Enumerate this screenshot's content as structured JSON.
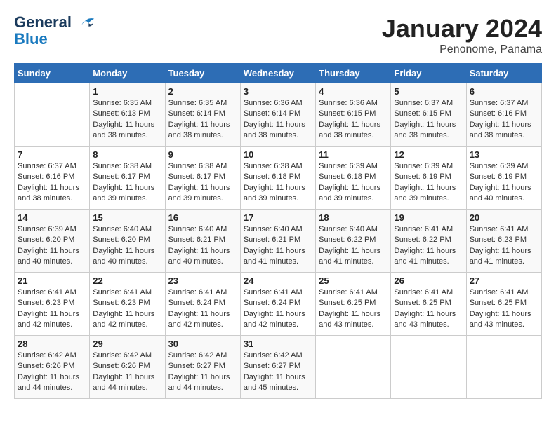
{
  "header": {
    "logo_line1": "General",
    "logo_line2": "Blue",
    "month": "January 2024",
    "location": "Penonome, Panama"
  },
  "weekdays": [
    "Sunday",
    "Monday",
    "Tuesday",
    "Wednesday",
    "Thursday",
    "Friday",
    "Saturday"
  ],
  "weeks": [
    [
      {
        "day": "",
        "sunrise": "",
        "sunset": "",
        "daylight": ""
      },
      {
        "day": "1",
        "sunrise": "Sunrise: 6:35 AM",
        "sunset": "Sunset: 6:13 PM",
        "daylight": "Daylight: 11 hours and 38 minutes."
      },
      {
        "day": "2",
        "sunrise": "Sunrise: 6:35 AM",
        "sunset": "Sunset: 6:14 PM",
        "daylight": "Daylight: 11 hours and 38 minutes."
      },
      {
        "day": "3",
        "sunrise": "Sunrise: 6:36 AM",
        "sunset": "Sunset: 6:14 PM",
        "daylight": "Daylight: 11 hours and 38 minutes."
      },
      {
        "day": "4",
        "sunrise": "Sunrise: 6:36 AM",
        "sunset": "Sunset: 6:15 PM",
        "daylight": "Daylight: 11 hours and 38 minutes."
      },
      {
        "day": "5",
        "sunrise": "Sunrise: 6:37 AM",
        "sunset": "Sunset: 6:15 PM",
        "daylight": "Daylight: 11 hours and 38 minutes."
      },
      {
        "day": "6",
        "sunrise": "Sunrise: 6:37 AM",
        "sunset": "Sunset: 6:16 PM",
        "daylight": "Daylight: 11 hours and 38 minutes."
      }
    ],
    [
      {
        "day": "7",
        "sunrise": "Sunrise: 6:37 AM",
        "sunset": "Sunset: 6:16 PM",
        "daylight": "Daylight: 11 hours and 38 minutes."
      },
      {
        "day": "8",
        "sunrise": "Sunrise: 6:38 AM",
        "sunset": "Sunset: 6:17 PM",
        "daylight": "Daylight: 11 hours and 39 minutes."
      },
      {
        "day": "9",
        "sunrise": "Sunrise: 6:38 AM",
        "sunset": "Sunset: 6:17 PM",
        "daylight": "Daylight: 11 hours and 39 minutes."
      },
      {
        "day": "10",
        "sunrise": "Sunrise: 6:38 AM",
        "sunset": "Sunset: 6:18 PM",
        "daylight": "Daylight: 11 hours and 39 minutes."
      },
      {
        "day": "11",
        "sunrise": "Sunrise: 6:39 AM",
        "sunset": "Sunset: 6:18 PM",
        "daylight": "Daylight: 11 hours and 39 minutes."
      },
      {
        "day": "12",
        "sunrise": "Sunrise: 6:39 AM",
        "sunset": "Sunset: 6:19 PM",
        "daylight": "Daylight: 11 hours and 39 minutes."
      },
      {
        "day": "13",
        "sunrise": "Sunrise: 6:39 AM",
        "sunset": "Sunset: 6:19 PM",
        "daylight": "Daylight: 11 hours and 40 minutes."
      }
    ],
    [
      {
        "day": "14",
        "sunrise": "Sunrise: 6:39 AM",
        "sunset": "Sunset: 6:20 PM",
        "daylight": "Daylight: 11 hours and 40 minutes."
      },
      {
        "day": "15",
        "sunrise": "Sunrise: 6:40 AM",
        "sunset": "Sunset: 6:20 PM",
        "daylight": "Daylight: 11 hours and 40 minutes."
      },
      {
        "day": "16",
        "sunrise": "Sunrise: 6:40 AM",
        "sunset": "Sunset: 6:21 PM",
        "daylight": "Daylight: 11 hours and 40 minutes."
      },
      {
        "day": "17",
        "sunrise": "Sunrise: 6:40 AM",
        "sunset": "Sunset: 6:21 PM",
        "daylight": "Daylight: 11 hours and 41 minutes."
      },
      {
        "day": "18",
        "sunrise": "Sunrise: 6:40 AM",
        "sunset": "Sunset: 6:22 PM",
        "daylight": "Daylight: 11 hours and 41 minutes."
      },
      {
        "day": "19",
        "sunrise": "Sunrise: 6:41 AM",
        "sunset": "Sunset: 6:22 PM",
        "daylight": "Daylight: 11 hours and 41 minutes."
      },
      {
        "day": "20",
        "sunrise": "Sunrise: 6:41 AM",
        "sunset": "Sunset: 6:23 PM",
        "daylight": "Daylight: 11 hours and 41 minutes."
      }
    ],
    [
      {
        "day": "21",
        "sunrise": "Sunrise: 6:41 AM",
        "sunset": "Sunset: 6:23 PM",
        "daylight": "Daylight: 11 hours and 42 minutes."
      },
      {
        "day": "22",
        "sunrise": "Sunrise: 6:41 AM",
        "sunset": "Sunset: 6:23 PM",
        "daylight": "Daylight: 11 hours and 42 minutes."
      },
      {
        "day": "23",
        "sunrise": "Sunrise: 6:41 AM",
        "sunset": "Sunset: 6:24 PM",
        "daylight": "Daylight: 11 hours and 42 minutes."
      },
      {
        "day": "24",
        "sunrise": "Sunrise: 6:41 AM",
        "sunset": "Sunset: 6:24 PM",
        "daylight": "Daylight: 11 hours and 42 minutes."
      },
      {
        "day": "25",
        "sunrise": "Sunrise: 6:41 AM",
        "sunset": "Sunset: 6:25 PM",
        "daylight": "Daylight: 11 hours and 43 minutes."
      },
      {
        "day": "26",
        "sunrise": "Sunrise: 6:41 AM",
        "sunset": "Sunset: 6:25 PM",
        "daylight": "Daylight: 11 hours and 43 minutes."
      },
      {
        "day": "27",
        "sunrise": "Sunrise: 6:41 AM",
        "sunset": "Sunset: 6:25 PM",
        "daylight": "Daylight: 11 hours and 43 minutes."
      }
    ],
    [
      {
        "day": "28",
        "sunrise": "Sunrise: 6:42 AM",
        "sunset": "Sunset: 6:26 PM",
        "daylight": "Daylight: 11 hours and 44 minutes."
      },
      {
        "day": "29",
        "sunrise": "Sunrise: 6:42 AM",
        "sunset": "Sunset: 6:26 PM",
        "daylight": "Daylight: 11 hours and 44 minutes."
      },
      {
        "day": "30",
        "sunrise": "Sunrise: 6:42 AM",
        "sunset": "Sunset: 6:27 PM",
        "daylight": "Daylight: 11 hours and 44 minutes."
      },
      {
        "day": "31",
        "sunrise": "Sunrise: 6:42 AM",
        "sunset": "Sunset: 6:27 PM",
        "daylight": "Daylight: 11 hours and 45 minutes."
      },
      {
        "day": "",
        "sunrise": "",
        "sunset": "",
        "daylight": ""
      },
      {
        "day": "",
        "sunrise": "",
        "sunset": "",
        "daylight": ""
      },
      {
        "day": "",
        "sunrise": "",
        "sunset": "",
        "daylight": ""
      }
    ]
  ]
}
